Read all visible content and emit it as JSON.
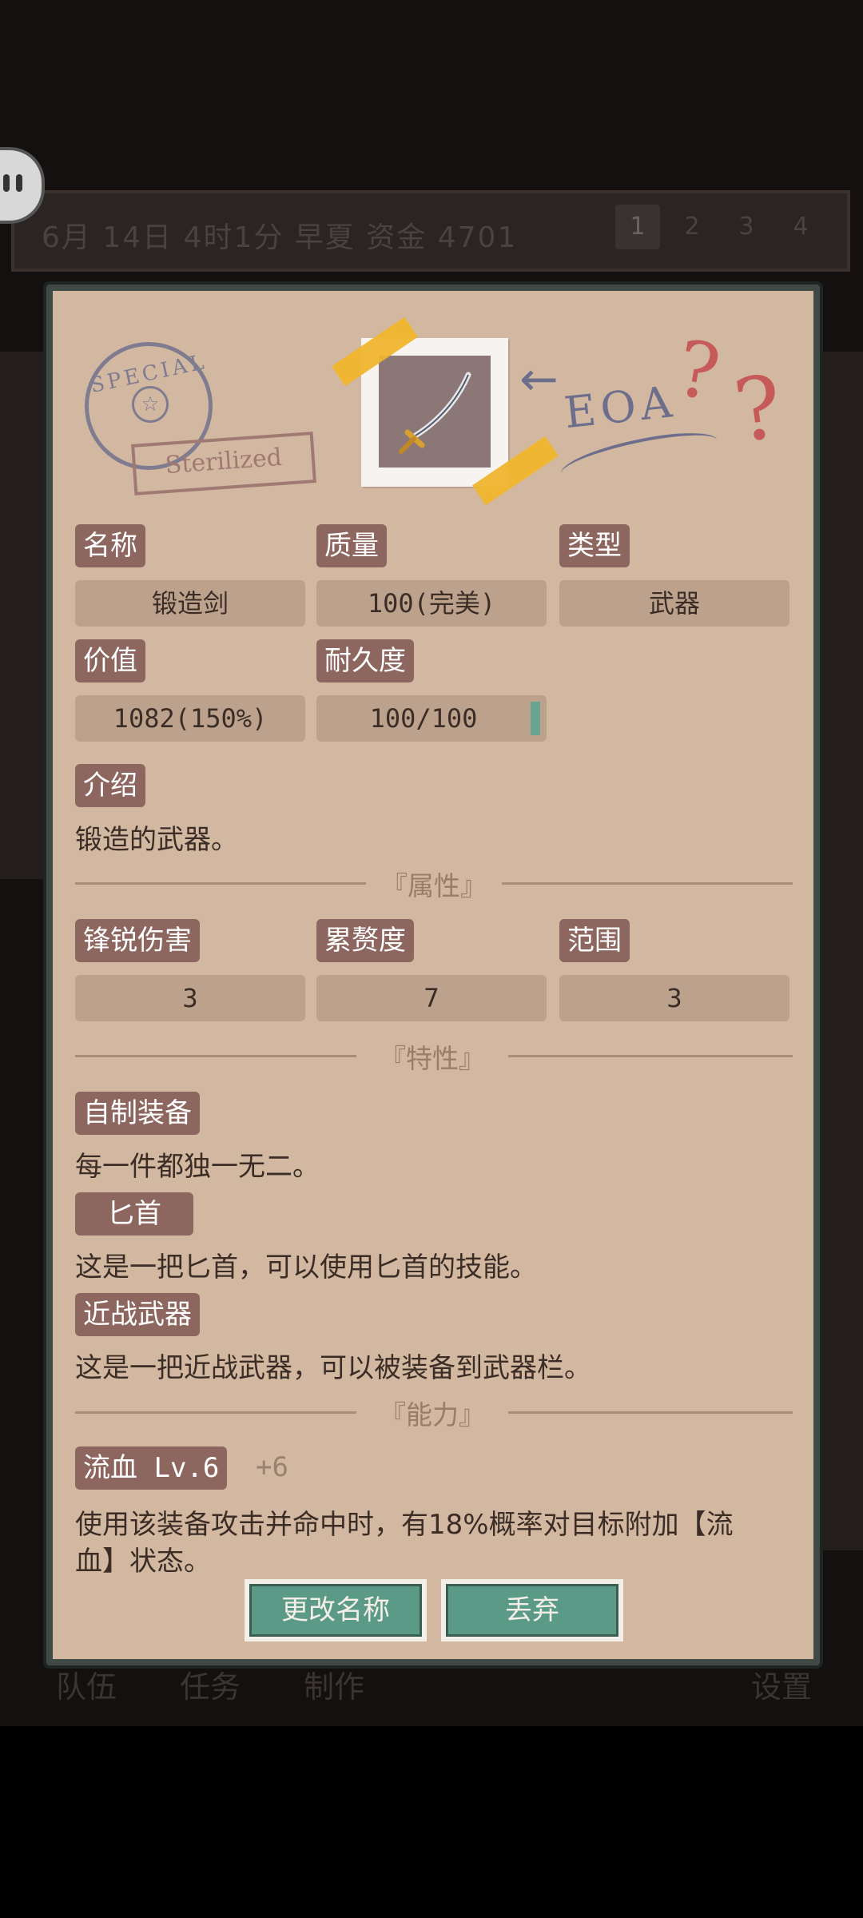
{
  "top_bar": {
    "status": "6月 14日 4时1分 早夏 资金 4701",
    "pages": [
      "1",
      "2",
      "3",
      "4"
    ]
  },
  "bottom_nav": [
    "队伍",
    "任务",
    "制作",
    "设置"
  ],
  "stamps": {
    "special": "SPECIAL",
    "sterilized": "Sterilized",
    "eoa": "EOA"
  },
  "fields": {
    "name_label": "名称",
    "name_value": "锻造剑",
    "quality_label": "质量",
    "quality_value": "100(完美)",
    "type_label": "类型",
    "type_value": "武器",
    "price_label": "价值",
    "price_value": "1082(150%)",
    "durability_label": "耐久度",
    "durability_value": "100/100",
    "intro_label": "介绍",
    "intro_text": "锻造的武器。"
  },
  "sections": {
    "attributes": "『属性』",
    "traits": "『特性』",
    "abilities": "『能力』"
  },
  "attributes": [
    {
      "label": "锋锐伤害",
      "value": "3"
    },
    {
      "label": "累赘度",
      "value": "7"
    },
    {
      "label": "范围",
      "value": "3"
    }
  ],
  "traits": [
    {
      "label": "自制装备",
      "text": "每一件都独一无二。"
    },
    {
      "label": "匕首",
      "text": "这是一把匕首，可以使用匕首的技能。"
    },
    {
      "label": "近战武器",
      "text": "这是一把近战武器，可以被装备到武器栏。"
    }
  ],
  "ability": {
    "label": "流血 Lv.6",
    "bonus": "+6",
    "text_line1": "使用该装备攻击并命中时，有18%概率对目标附加【流",
    "text_line2": "血】状态。"
  },
  "buttons": {
    "rename": "更改名称",
    "discard": "丢弃"
  },
  "durability_fraction": 1.0
}
